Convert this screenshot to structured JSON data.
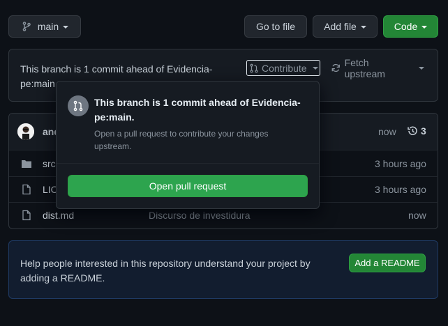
{
  "toolbar": {
    "branch_label": "main",
    "go_to_file_label": "Go to file",
    "add_file_label": "Add file",
    "code_label": "Code"
  },
  "branch_status": {
    "message_line1": "This branch is 1 commit ahead of Evidencia-",
    "message_line2": "pe:main",
    "contribute_label": "Contribute",
    "fetch_upstream_label": "Fetch upstream"
  },
  "commit_header": {
    "author": "and",
    "time": "now",
    "commit_count": "3"
  },
  "files": [
    {
      "name": "src",
      "message": "",
      "time": "3 hours ago",
      "icon": "folder-icon"
    },
    {
      "name": "LIC",
      "message": "",
      "time": "3 hours ago",
      "icon": "file-icon"
    },
    {
      "name": "dist.md",
      "message": "Discurso de investidura",
      "time": "now",
      "icon": "file-icon"
    }
  ],
  "popover": {
    "title_line1": "This branch is 1 commit ahead of Evidencia-",
    "title_line2": "pe:main.",
    "description_line1": "Open a pull request to contribute your changes",
    "description_line2": "upstream.",
    "open_pr_label": "Open pull request"
  },
  "readme": {
    "text_line1": "Help people interested in this repository understand your project by",
    "text_line2": "adding a README.",
    "button_label": "Add a README"
  },
  "colors": {
    "background": "#0d1117",
    "surface": "#161b22",
    "border": "#30363d",
    "green": "#238636",
    "readme_bg": "#121d2f",
    "readme_border": "#1f3a63"
  }
}
